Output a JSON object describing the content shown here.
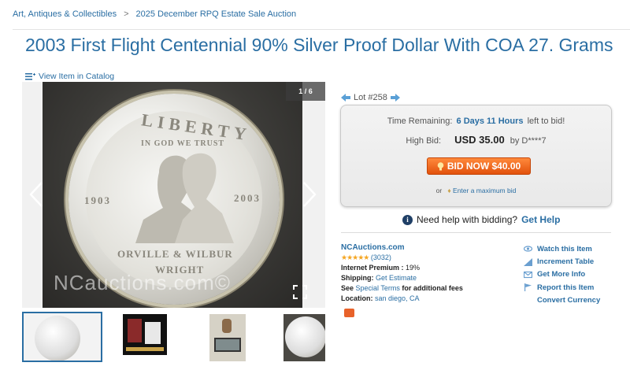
{
  "breadcrumb": {
    "category": "Art, Antiques & Collectibles",
    "separator": ">",
    "auction": "2025 December RPQ Estate Sale Auction"
  },
  "title": "2003 First Flight Centennial 90% Silver Proof Dollar With COA 27. Grams",
  "catalog_link": "View Item in Catalog",
  "image": {
    "counter": "1 / 6",
    "watermark": "NCauctions.com©",
    "coin_text": {
      "liberty": "LIBERTY",
      "trust": "IN GOD WE TRUST",
      "year_left": "1903",
      "year_right": "2003",
      "names": "ORVILLE & WILBUR",
      "wright": "WRIGHT"
    }
  },
  "lot": "Lot #258",
  "bidding": {
    "time_label": "Time Remaining:",
    "time_value": "6 Days 11 Hours",
    "time_suffix": "left to bid!",
    "high_bid_label": "High Bid:",
    "high_bid_amount": "USD 35.00",
    "high_bid_by": "by D****7",
    "bid_button": "BID NOW $40.00",
    "or": "or",
    "max_bid_link": "Enter a maximum bid"
  },
  "help": {
    "text": "Need help with bidding?",
    "link": "Get Help"
  },
  "seller": {
    "name": "NCAuctions.com",
    "stars": "★★★★★",
    "rating_count": "(3032)",
    "premium_label": "Internet Premium :",
    "premium_value": "19%",
    "shipping_label": "Shipping:",
    "shipping_link": "Get Estimate",
    "see": "See",
    "terms_link": "Special Terms",
    "terms_suffix": "for additional fees",
    "location_label": "Location:",
    "location_value": "san diego, CA"
  },
  "actions": [
    {
      "label": "Watch this Item",
      "icon": "eye-icon"
    },
    {
      "label": "Increment Table",
      "icon": "chart-icon"
    },
    {
      "label": "Get More Info",
      "icon": "mail-icon"
    },
    {
      "label": "Report this Item",
      "icon": "flag-icon"
    },
    {
      "label": "Convert Currency",
      "icon": ""
    }
  ],
  "colors": {
    "link": "#2a6ea3",
    "bid_button": "#e2510c",
    "stars": "#f5a623"
  }
}
